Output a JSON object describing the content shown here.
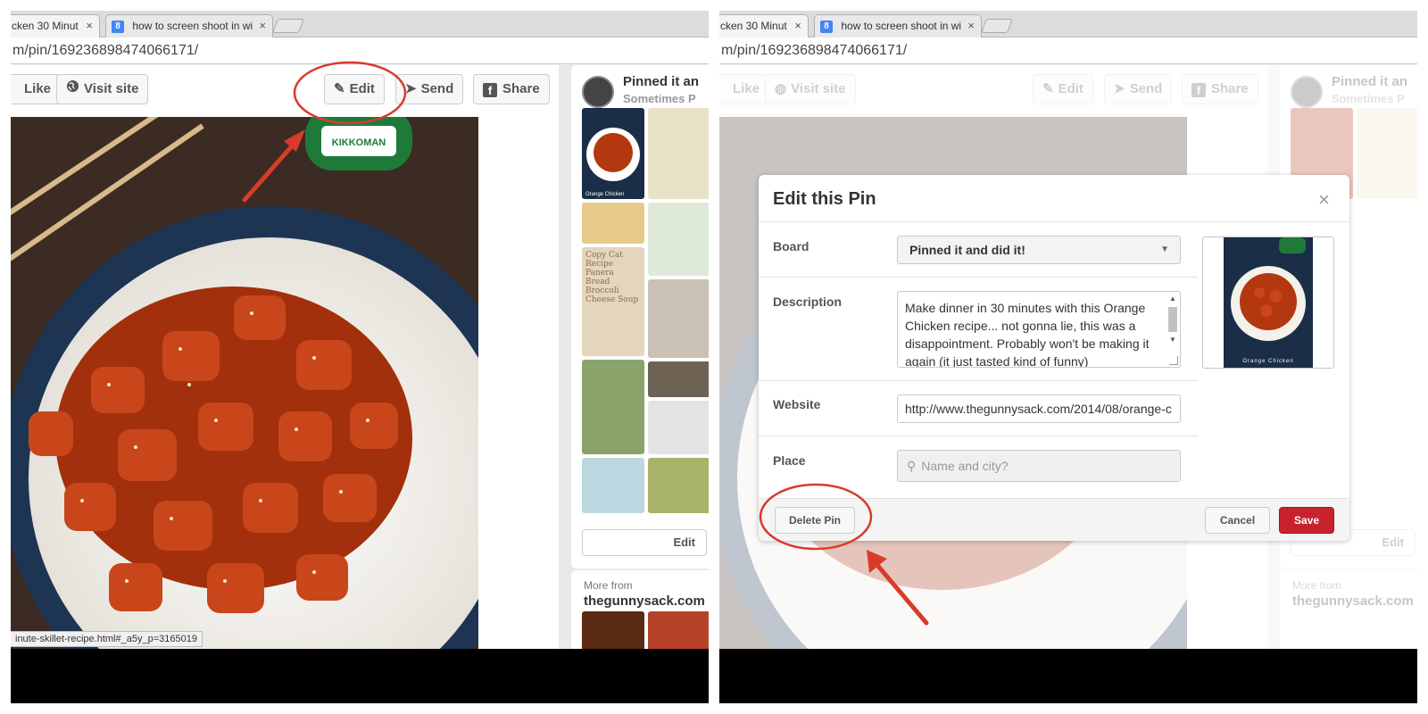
{
  "browser": {
    "tabs": [
      {
        "label": "cken 30 Minut",
        "close": "×"
      },
      {
        "label": "how to screen shoot in wi",
        "close": "×",
        "favicon": "8"
      }
    ],
    "url": "m/pin/169236898474066171/"
  },
  "pin_view": {
    "buttons": {
      "like": "Like",
      "visit": "Visit site",
      "edit": "Edit",
      "send": "Send",
      "share": "Share"
    },
    "board_title": "Pinned it an",
    "board_subtitle": "Sometimes P",
    "board_edit": "Edit",
    "more_from": "More from",
    "more_site": "thegunnysack.com",
    "status_url": "inute-skillet-recipe.html#_a5y_p=3165019",
    "tile_text_orange": "Orange Chicken",
    "tile_text_panera": "Copy Cat Recipe Panera Bread Broccoli Cheese Soup"
  },
  "edit_modal": {
    "title": "Edit this Pin",
    "close": "×",
    "board_label": "Board",
    "board_value": "Pinned it and did it!",
    "description_label": "Description",
    "description_value": "Make dinner in 30 minutes with this Orange Chicken recipe... not gonna lie, this was a disappointment. Probably won't be making it again (it just tasted kind of funny)",
    "website_label": "Website",
    "website_value": "http://www.thegunnysack.com/2014/08/orange-c",
    "place_label": "Place",
    "place_placeholder": "Name and city?",
    "preview_caption": "Orange Chicken",
    "delete_button": "Delete Pin",
    "cancel_button": "Cancel",
    "save_button": "Save"
  },
  "colors": {
    "save_red": "#c8232c",
    "annotation_red": "#d93b2a"
  },
  "icons": [
    "pencil-icon",
    "globe-icon",
    "send-icon",
    "facebook-icon",
    "search-icon",
    "close-icon",
    "caret-down-icon"
  ]
}
